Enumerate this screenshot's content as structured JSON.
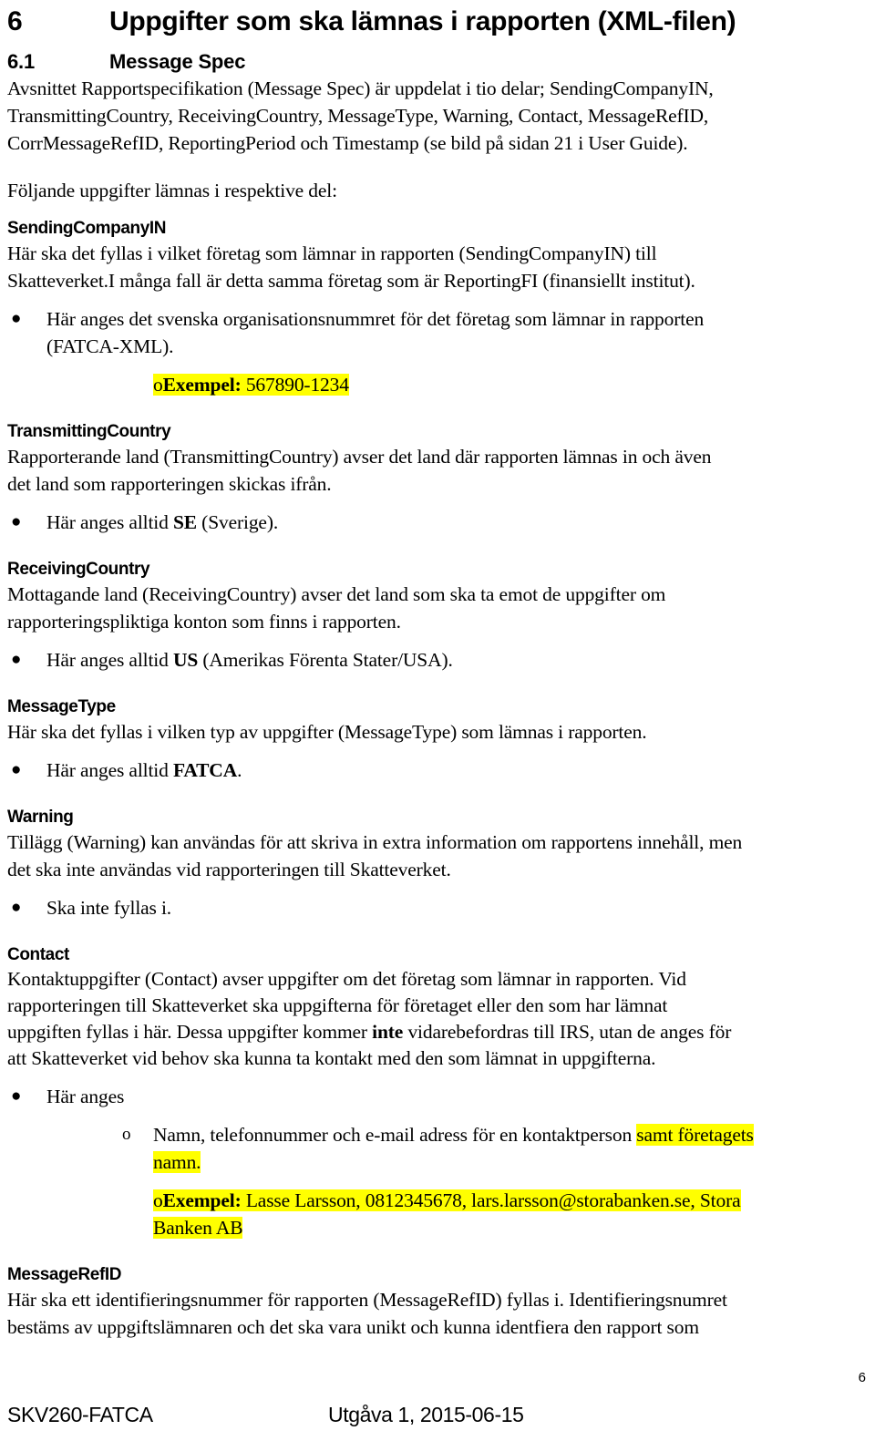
{
  "document": {
    "heading1": {
      "number": "6",
      "title": "Uppgifter som ska lämnas i rapporten (XML-filen)"
    },
    "heading2": {
      "number": "6.1",
      "title": "Message Spec"
    },
    "intro": {
      "line1": "Avsnittet Rapportspecifikation (Message Spec) är uppdelat i tio delar; SendingCompanyIN,",
      "line2": "TransmittingCountry, ReceivingCountry, MessageType, Warning, Contact, MessageRefID,",
      "line3": "CorrMessageRefID, ReportingPeriod och Timestamp (se bild på sidan 21 i User Guide)."
    },
    "lead": "Följande uppgifter lämnas i respektive del:",
    "sections": {
      "sending_company_in": {
        "heading": "SendingCompanyIN",
        "body_line1": "Här ska det fyllas i vilket företag som lämnar in rapporten (SendingCompanyIN) till",
        "body_line2": "Skatteverket.I många fall är detta samma företag som är ReportingFI (finansiellt institut).",
        "bullet_line1": "Här anges det svenska organisationsnummret för det företag som lämnar in rapporten",
        "bullet_line2": "(FATCA-XML).",
        "example_marker": "o",
        "example_label": "Exempel:",
        "example_value": "567890-1234"
      },
      "transmitting_country": {
        "heading": "TransmittingCountry",
        "body_line1": "Rapporterande land (TransmittingCountry) avser det land där rapporten lämnas in och även",
        "body_line2": "det land som rapporteringen skickas ifrån.",
        "bullet_pre": "Här anges alltid ",
        "bullet_bold": "SE",
        "bullet_post": " (Sverige)."
      },
      "receiving_country": {
        "heading": "ReceivingCountry",
        "body_line1": "Mottagande land (ReceivingCountry) avser det land som ska ta emot de uppgifter om",
        "body_line2": "rapporteringspliktiga konton som finns i rapporten.",
        "bullet_pre": "Här anges alltid ",
        "bullet_bold": "US",
        "bullet_post": " (Amerikas Förenta Stater/USA)."
      },
      "message_type": {
        "heading": "MessageType",
        "body_line1": "Här ska det fyllas i vilken typ av uppgifter (MessageType) som lämnas i rapporten.",
        "bullet_pre": "Här anges alltid ",
        "bullet_bold": "FATCA",
        "bullet_post": "."
      },
      "warning": {
        "heading": "Warning",
        "body_line1": "Tillägg (Warning) kan användas för att skriva in extra information om rapportens innehåll, men",
        "body_line2": "det ska inte användas vid rapporteringen till Skatteverket.",
        "bullet": "Ska inte fyllas i."
      },
      "contact": {
        "heading": "Contact",
        "body_line1_a": "Kontaktuppgifter (Contact) avser uppgifter om det företag som lämnar in rapporten. Vid",
        "body_line2_a": "rapporteringen till Skatteverket ska uppgifterna för företaget eller den som har lämnat",
        "body_line3_a": "uppgiften fyllas i här. Dessa uppgifter kommer ",
        "body_line3_bold": "inte",
        "body_line3_b": " vidarebefordras till IRS, utan de anges för",
        "body_line4": "att Skatteverket vid behov ska kunna ta kontakt med den som lämnat in uppgifterna.",
        "bullet": "Här anges",
        "sub1_marker": "o",
        "sub1_plain": "Namn, telefonnummer och e-mail adress för en kontaktperson ",
        "sub1_highlight_a": "samt företagets",
        "sub1_highlight_b": "namn.",
        "sub2_marker": "o",
        "sub2_label": "Exempel:",
        "sub2_value_line1": " Lasse Larsson, 0812345678, lars.larsson@storabanken.se, Stora",
        "sub2_value_line2": "Banken AB"
      },
      "message_ref_id": {
        "heading": "MessageRefID",
        "body_line1": "Här ska ett identifieringsnummer för rapporten (MessageRefID) fyllas i. Identifieringsnumret",
        "body_line2": "bestäms av uppgiftslämnaren och det ska vara unikt och kunna identfiera den rapport som"
      }
    },
    "footer": {
      "document_code": "SKV260-FATCA",
      "edition": "Utgåva 1,  2015-06-15",
      "page_number": "6"
    },
    "colors": {
      "highlight": "#ffff00",
      "text": "#000000",
      "background": "#ffffff"
    }
  }
}
